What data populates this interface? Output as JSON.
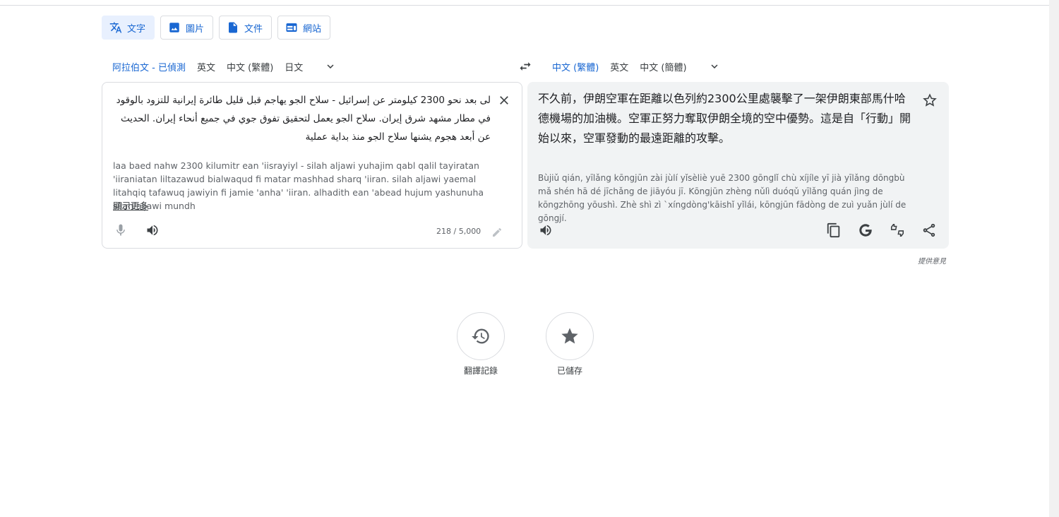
{
  "modes": [
    {
      "label": "文字",
      "icon": "translate-icon",
      "active": true
    },
    {
      "label": "圖片",
      "icon": "image-icon",
      "active": false
    },
    {
      "label": "文件",
      "icon": "document-icon",
      "active": false
    },
    {
      "label": "網站",
      "icon": "website-icon",
      "active": false
    }
  ],
  "source_langs": [
    "阿拉伯文 - 已偵測",
    "英文",
    "中文 (繁體)",
    "日文"
  ],
  "target_langs": [
    "中文 (繁體)",
    "英文",
    "中文 (簡體)"
  ],
  "source": {
    "text": "لى بعد نحو 2300 كيلومتر عن إسرائيل - سلاح الجو يهاجم قبل قليل طائرة إيرانية للتزود بالوقود في مطار مشهد شرق إيران. سلاح الجو يعمل لتحقيق تفوق جوي في جميع أنحاء إيران. الحديث عن أبعد هجوم يشنها سلاح الجو منذ بداية عملية",
    "transliteration": "laa baed nahw 2300 kilumitr ean 'iisrayiyl - silah aljawi yuhajim qabl qalil tayiratan 'iiraniatan liltazawud bialwaqud fi matar mashhad sharq 'iiran. silah aljawi yaemal litahqiq tafawuq jawiyin fi jamie 'anha' 'iiran. alhadith ean 'abead hujum yashunuha silah aljawi mundh",
    "show_more": "顯示更多",
    "counter": "218 / 5,000"
  },
  "target": {
    "text": "不久前，伊朗空軍在距離以色列約2300公里處襲擊了一架伊朗東部馬什哈德機場的加油機。空軍正努力奪取伊朗全境的空中優勢。這是自「行動」開始以來，空軍發動的最遠距離的攻擊。",
    "transliteration": "Bùjiǔ qián, yīlǎng kōngjūn zài jùlí yǐsèliè yuē 2300 gōnglǐ chù xíjíle yī jià yīlǎng dōngbù mǎ shén hā dé jīchǎng de jiāyóu jī. Kōngjūn zhèng nǔlì duóqǔ yīlǎng quán jìng de kōngzhōng yōushì. Zhè shì zì `xíngdòng'kāishǐ yǐlái, kōngjūn fādòng de zuì yuǎn jùlí de gōngjí."
  },
  "feedback": "提供意見",
  "bottom": {
    "history_label": "翻譯記錄",
    "saved_label": "已儲存"
  },
  "colors": {
    "accent": "#1967d2",
    "panel": "#f1f3f4"
  }
}
